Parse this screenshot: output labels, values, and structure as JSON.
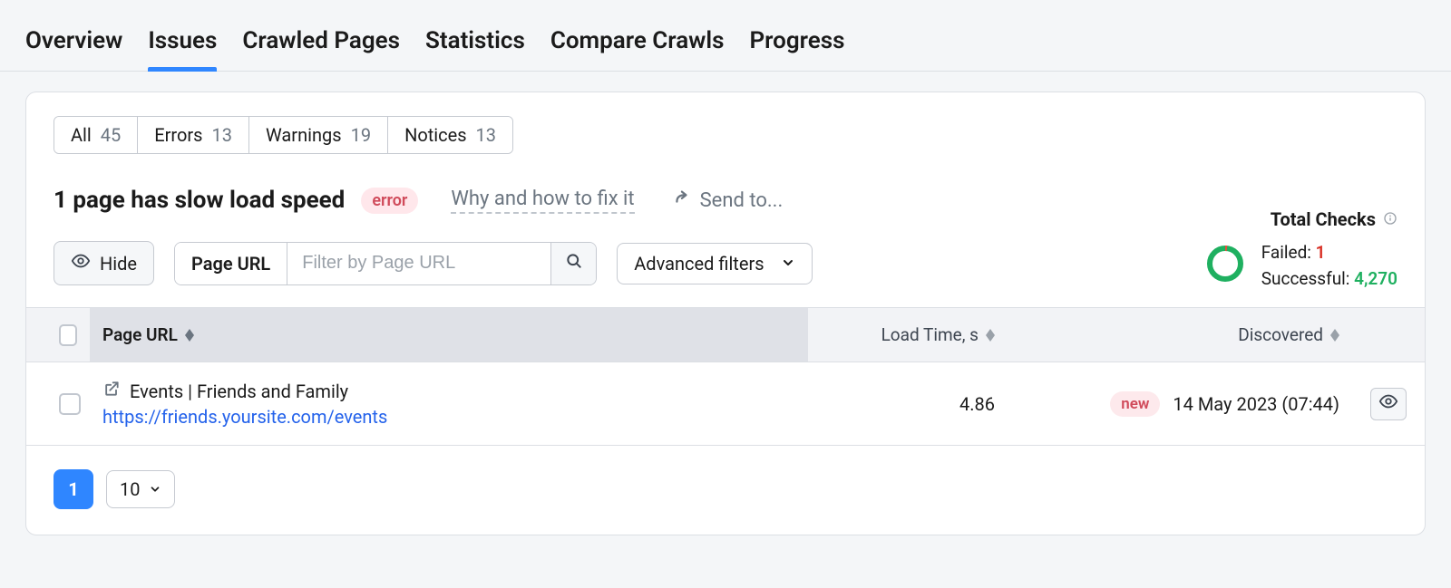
{
  "nav": {
    "tabs": [
      "Overview",
      "Issues",
      "Crawled Pages",
      "Statistics",
      "Compare Crawls",
      "Progress"
    ],
    "active_index": 1
  },
  "issue_filters": [
    {
      "label": "All",
      "count": "45"
    },
    {
      "label": "Errors",
      "count": "13"
    },
    {
      "label": "Warnings",
      "count": "19"
    },
    {
      "label": "Notices",
      "count": "13"
    }
  ],
  "heading": {
    "title": "1 page has slow load speed",
    "badge": "error",
    "fix_link": "Why and how to fix it",
    "send_to": "Send to..."
  },
  "filters": {
    "hide_label": "Hide",
    "field_label": "Page URL",
    "placeholder": "Filter by Page URL",
    "advanced_label": "Advanced filters"
  },
  "total_checks": {
    "title": "Total Checks",
    "failed_label": "Failed:",
    "failed_value": "1",
    "successful_label": "Successful:",
    "successful_value": "4,270"
  },
  "table": {
    "columns": {
      "page_url": "Page URL",
      "load_time": "Load Time, s",
      "discovered": "Discovered"
    },
    "rows": [
      {
        "title": "Events | Friends and Family",
        "url": "https://friends.yoursite.com/events",
        "load_time": "4.86",
        "new_badge": "new",
        "discovered": "14 May 2023 (07:44)"
      }
    ]
  },
  "pagination": {
    "current_page": "1",
    "page_size": "10"
  }
}
